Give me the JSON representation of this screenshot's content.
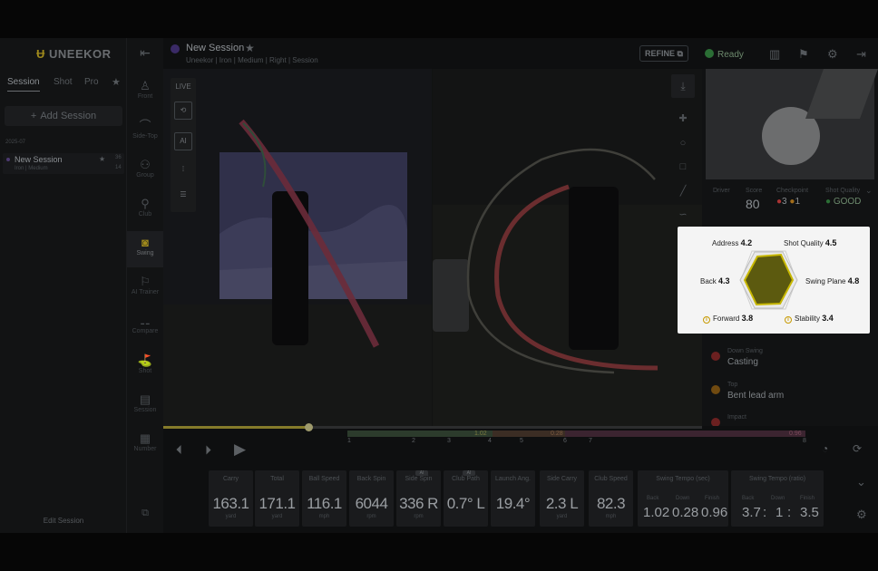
{
  "brand": {
    "logo_text": "UNEEKOR"
  },
  "left_panel": {
    "tabs": [
      "Session",
      "Shot",
      "Pro"
    ],
    "add_session_label": "Add Session",
    "date_header": "2025-07",
    "session_item": {
      "name": "New Session",
      "subtitle": "Iron | Medium",
      "count_top": "36",
      "count_bottom": "14"
    },
    "edit_session_label": "Edit Session"
  },
  "icon_rail": {
    "items": [
      {
        "label": "Front",
        "icon": "figure-front-icon"
      },
      {
        "label": "Side-Top",
        "icon": "arc-icon"
      },
      {
        "label": "Group",
        "icon": "group-icon"
      },
      {
        "label": "Club",
        "icon": "club-icon"
      },
      {
        "label": "Swing",
        "icon": "camera-icon",
        "active": true
      },
      {
        "label": "AI Trainer",
        "icon": "trainer-icon"
      },
      {
        "label": "Compare",
        "icon": "compare-icon"
      },
      {
        "label": "Shot",
        "icon": "shot-icon"
      },
      {
        "label": "Session",
        "icon": "session-icon"
      },
      {
        "label": "Number",
        "icon": "number-icon"
      }
    ]
  },
  "header": {
    "title": "New Session",
    "subtitle": "Uneekor  |  Iron  |  Medium  |  Right  |  Session",
    "refine_label": "REFINE",
    "status": "Ready",
    "status_color": "#2b6e35"
  },
  "video": {
    "live_label": "LIVE",
    "ai_label": "AI"
  },
  "right_panel": {
    "stats": {
      "club_label": "Driver",
      "score_label": "Score",
      "score_value": "80",
      "checkpoint_label": "Checkpoint",
      "checkpoint_red": "3",
      "checkpoint_orange": "1",
      "quality_label": "Shot Quality",
      "quality_value": "GOOD"
    },
    "insights": [
      {
        "header": "Down Swing",
        "value": "Casting",
        "color": "#b0312e"
      },
      {
        "header": "Top",
        "value": "Bent lead arm",
        "color": "#c0801a"
      },
      {
        "header": "Impact",
        "value": "",
        "color": "#b0312e"
      }
    ]
  },
  "hex_card": {
    "address_label": "Address",
    "address_value": "4.2",
    "shot_quality_label": "Shot Quality",
    "shot_quality_value": "4.5",
    "back_label": "Back",
    "back_value": "4.3",
    "swing_plane_label": "Swing Plane",
    "swing_plane_value": "4.8",
    "forward_label": "Forward",
    "forward_value": "3.8",
    "stability_label": "Stability",
    "stability_value": "3.4"
  },
  "timeline": {
    "markers": [
      "1",
      "2",
      "3",
      "4",
      "5",
      "6",
      "7",
      "8"
    ],
    "tempo_labels": [
      "1.02",
      "0.28",
      "0.96"
    ],
    "progress": 0.27
  },
  "metrics": [
    {
      "label": "Carry",
      "value": "163.1",
      "unit": "yard"
    },
    {
      "label": "Total",
      "value": "171.1",
      "unit": "yard"
    },
    {
      "label": "Ball Speed",
      "value": "116.1",
      "unit": "mph"
    },
    {
      "label": "Back Spin",
      "value": "6044",
      "unit": "rpm"
    },
    {
      "label": "Side Spin",
      "value": "336 R",
      "unit": "rpm",
      "ai": "AI"
    },
    {
      "label": "Club Path",
      "value": "0.7° L",
      "unit": "",
      "ai": "AI"
    },
    {
      "label": "Launch Ang.",
      "value": "19.4°",
      "unit": ""
    },
    {
      "label": "Side Carry",
      "value": "2.3 L",
      "unit": "yard"
    },
    {
      "label": "Club Speed",
      "value": "82.3",
      "unit": "mph"
    }
  ],
  "tempo_sec": {
    "label": "Swing Tempo (sec)",
    "cols": [
      "Back",
      "Down",
      "Finish"
    ],
    "values": [
      "1.02",
      "0.28",
      "0.96"
    ]
  },
  "tempo_ratio": {
    "label": "Swing Tempo (ratio)",
    "cols": [
      "Back",
      "Down",
      "Finish"
    ],
    "values": [
      "3.7",
      "1",
      "3.5"
    ],
    "sep": ":"
  }
}
